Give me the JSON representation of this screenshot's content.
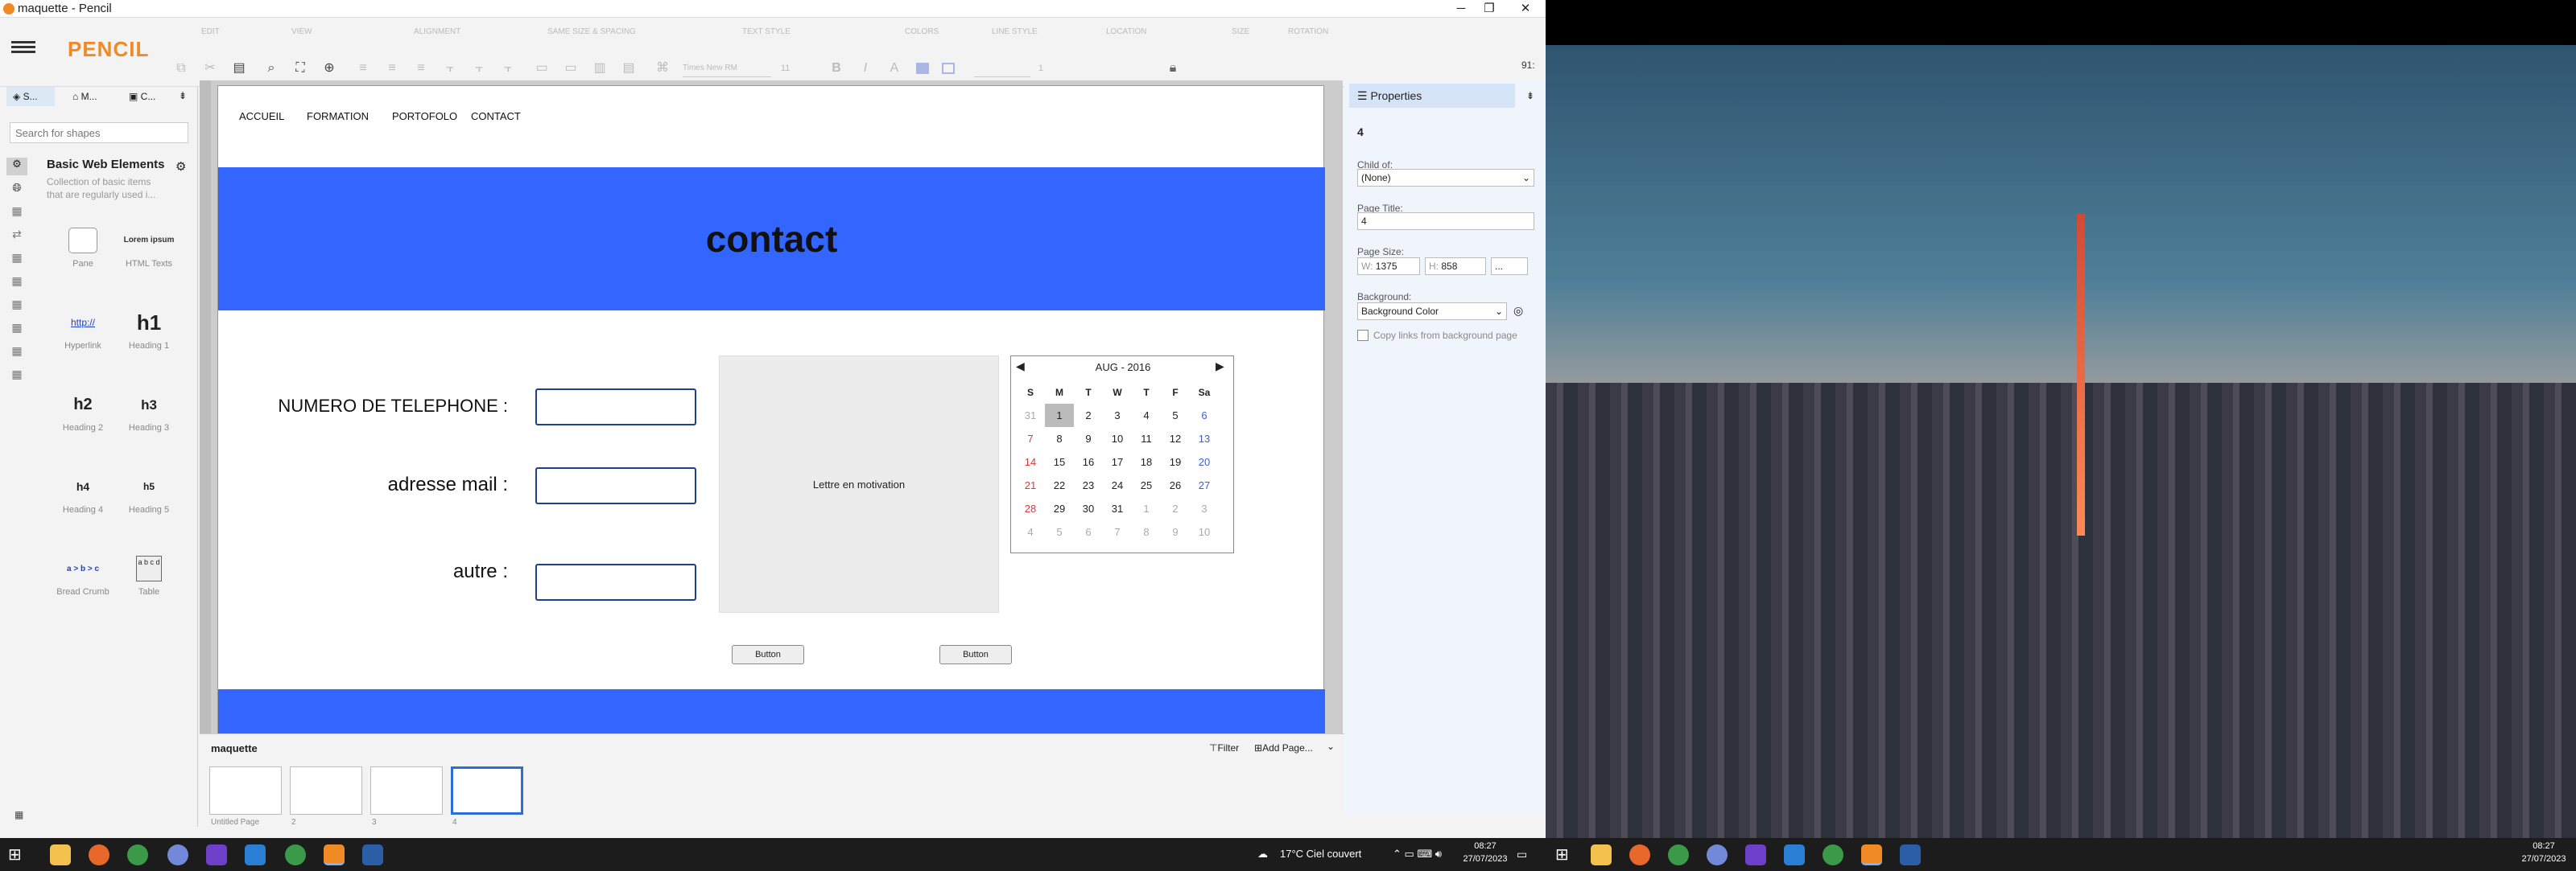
{
  "window": {
    "title": "maquette - Pencil"
  },
  "titlebar_controls": {
    "min": "─",
    "max": "❐",
    "close": "✕"
  },
  "app": {
    "logo_text": "PENCIL",
    "accent": "#f08a24",
    "corner_label": "91:"
  },
  "toolbar_groups": [
    "EDIT",
    "VIEW",
    "ALIGNMENT",
    "SAME SIZE & SPACING",
    "TEXT STYLE",
    "COLORS",
    "LINE STYLE",
    "LOCATION",
    "SIZE",
    "ROTATION"
  ],
  "toolbar": {
    "font_name": "Times New RM",
    "font_size": "11",
    "line_width": "1"
  },
  "sidebar": {
    "tabs": [
      "S...",
      "M...",
      "C..."
    ],
    "search_placeholder": "Search for shapes",
    "collection_title": "Basic Web Elements",
    "collection_desc": "Collection of basic items that are regularly used i...",
    "shapes": [
      {
        "name": "Pane",
        "icon": "pane-icon"
      },
      {
        "name": "HTML Texts",
        "icon": "lorem-icon",
        "preview": "Lorem ipsum"
      },
      {
        "name": "Hyperlink",
        "icon": "hyperlink-icon",
        "preview": "http://"
      },
      {
        "name": "Heading 1",
        "icon": "h1-icon",
        "preview": "h1"
      },
      {
        "name": "Heading 2",
        "icon": "h2-icon",
        "preview": "h2"
      },
      {
        "name": "Heading 3",
        "icon": "h3-icon",
        "preview": "h3"
      },
      {
        "name": "Heading 4",
        "icon": "h4-icon",
        "preview": "h4"
      },
      {
        "name": "Heading 5",
        "icon": "h5-icon",
        "preview": "h5"
      },
      {
        "name": "Bread Crumb",
        "icon": "breadcrumb-icon",
        "preview": "a > b > c"
      },
      {
        "name": "Table",
        "icon": "table-icon",
        "preview": "a b c d"
      }
    ]
  },
  "page": {
    "nav": [
      "ACCUEIL",
      "FORMATION",
      "PORTOFOLO",
      "CONTACT"
    ],
    "banner_title": "contact",
    "banner_color": "#3366ff",
    "fields": [
      {
        "label": "NUMERO DE TELEPHONE :"
      },
      {
        "label": "adresse mail :"
      },
      {
        "label": "autre :"
      }
    ],
    "motivation_text": "Lettre en motivation",
    "buttons": [
      "Button",
      "Button"
    ]
  },
  "calendar": {
    "title": "AUG - 2016",
    "days": [
      "S",
      "M",
      "T",
      "W",
      "T",
      "F",
      "Sa"
    ],
    "weeks": [
      [
        "31",
        "1",
        "2",
        "3",
        "4",
        "5",
        "6"
      ],
      [
        "7",
        "8",
        "9",
        "10",
        "11",
        "12",
        "13"
      ],
      [
        "14",
        "15",
        "16",
        "17",
        "18",
        "19",
        "20"
      ],
      [
        "21",
        "22",
        "23",
        "24",
        "25",
        "26",
        "27"
      ],
      [
        "28",
        "29",
        "30",
        "31",
        "1",
        "2",
        "3"
      ],
      [
        "4",
        "5",
        "6",
        "7",
        "8",
        "9",
        "10"
      ]
    ],
    "selected": "1"
  },
  "properties": {
    "title": "Properties",
    "page_name": "4",
    "child_of_label": "Child of:",
    "child_of_value": "(None)",
    "page_title_label": "Page Title:",
    "page_title_value": "4",
    "page_size_label": "Page Size:",
    "w_label": "W:",
    "w_value": "1375",
    "h_label": "H:",
    "h_value": "858",
    "size_preset": "...",
    "background_label": "Background:",
    "background_value": "Background Color",
    "copy_links_label": "Copy links from background page"
  },
  "pages_panel": {
    "doc_name": "maquette",
    "filter_label": "Filter",
    "add_page_label": "Add Page...",
    "pages": [
      "Untitled Page",
      "2",
      "3",
      "4"
    ]
  },
  "taskbar_left": {
    "weather": "17°C Ciel couvert",
    "time": "08:27",
    "date": "27/07/2023"
  },
  "taskbar_right": {
    "time": "08:27",
    "date": "27/07/2023"
  }
}
